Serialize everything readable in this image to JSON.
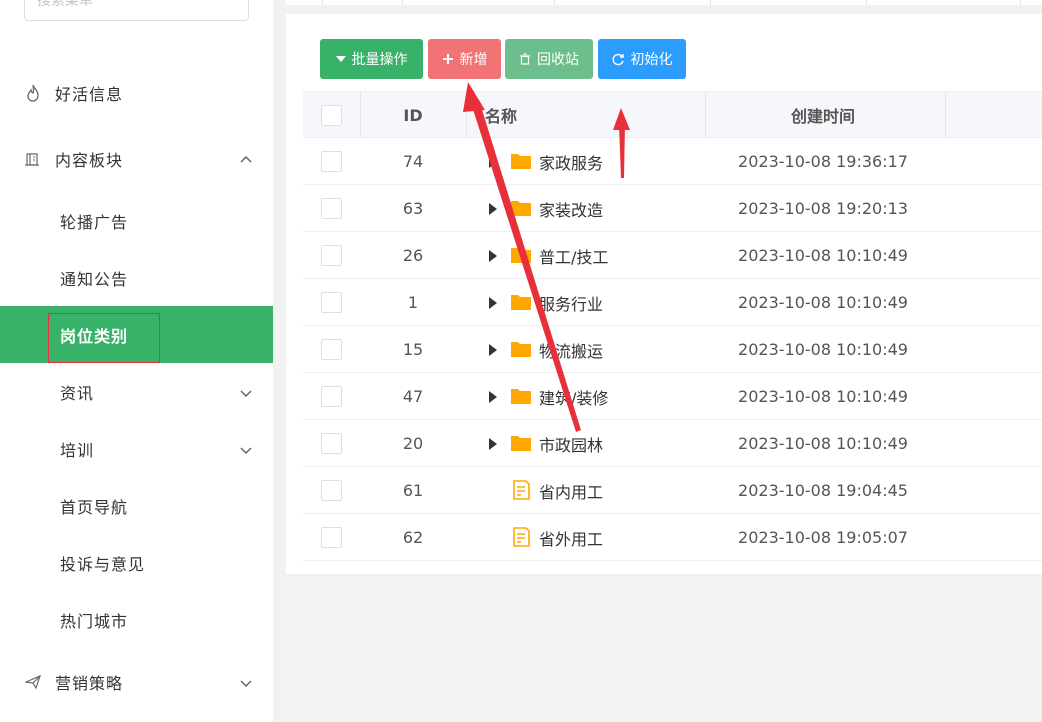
{
  "sidebar": {
    "search_placeholder": "搜索菜单",
    "items": [
      {
        "label": "好活信息",
        "icon": "fire-icon"
      },
      {
        "label": "内容板块",
        "icon": "building-icon",
        "expanded": true
      },
      {
        "label": "轮播广告"
      },
      {
        "label": "通知公告"
      },
      {
        "label": "岗位类别",
        "active": true
      },
      {
        "label": "资讯"
      },
      {
        "label": "培训"
      },
      {
        "label": "首页导航"
      },
      {
        "label": "投诉与意见"
      },
      {
        "label": "热门城市"
      },
      {
        "label": "营销策略",
        "icon": "paper-plane-icon"
      }
    ]
  },
  "toolbar": {
    "batch": "批量操作",
    "add": "新增",
    "recycle": "回收站",
    "init": "初始化"
  },
  "table": {
    "headers": {
      "id": "ID",
      "name": "名称",
      "created": "创建时间"
    },
    "rows": [
      {
        "id": "74",
        "name": "家政服务",
        "created": "2023-10-08 19:36:17",
        "type": "folder"
      },
      {
        "id": "63",
        "name": "家装改造",
        "created": "2023-10-08 19:20:13",
        "type": "folder"
      },
      {
        "id": "26",
        "name": "普工/技工",
        "created": "2023-10-08 10:10:49",
        "type": "folder"
      },
      {
        "id": "1",
        "name": "服务行业",
        "created": "2023-10-08 10:10:49",
        "type": "folder"
      },
      {
        "id": "15",
        "name": "物流搬运",
        "created": "2023-10-08 10:10:49",
        "type": "folder"
      },
      {
        "id": "47",
        "name": "建筑/装修",
        "created": "2023-10-08 10:10:49",
        "type": "folder"
      },
      {
        "id": "20",
        "name": "市政园林",
        "created": "2023-10-08 10:10:49",
        "type": "folder"
      },
      {
        "id": "61",
        "name": "省内用工",
        "created": "2023-10-08 19:04:45",
        "type": "file"
      },
      {
        "id": "62",
        "name": "省外用工",
        "created": "2023-10-08 19:05:07",
        "type": "file"
      }
    ]
  },
  "colors": {
    "primary": "#38b269",
    "danger": "#f17376",
    "info": "#2d9cff",
    "folder": "#ffa800",
    "annotation": "#e8303a"
  }
}
